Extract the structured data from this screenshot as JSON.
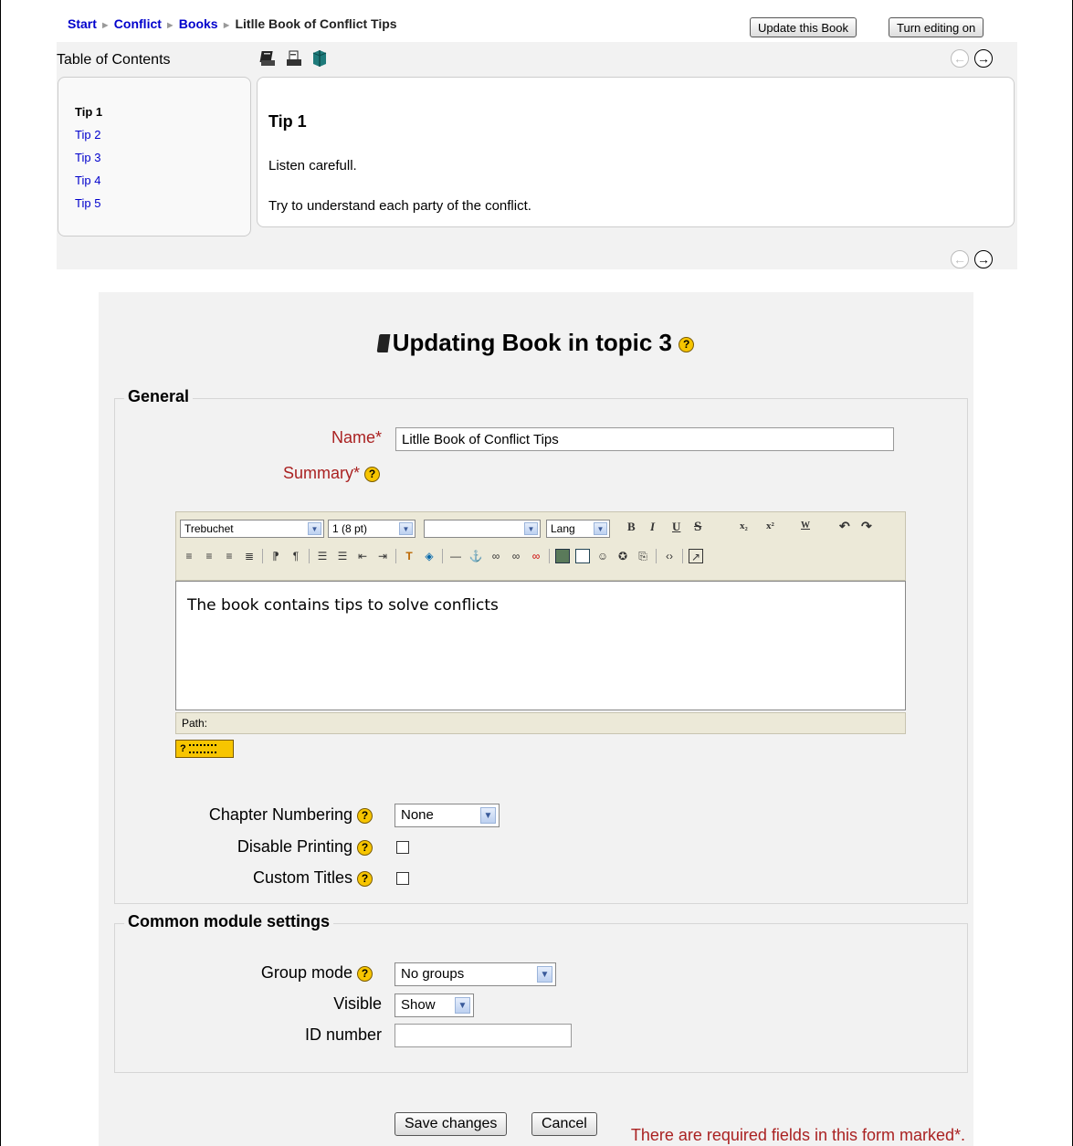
{
  "breadcrumb": {
    "items": [
      "Start",
      "Conflict",
      "Books"
    ],
    "current": "Litlle Book of Conflict Tips",
    "separator": "►"
  },
  "header_buttons": {
    "update_book": "Update this Book",
    "editing": "Turn editing on"
  },
  "toc": {
    "heading": "Table of Contents",
    "items": [
      "Tip 1",
      "Tip 2",
      "Tip 3",
      "Tip 4",
      "Tip 5"
    ],
    "current_index": 0
  },
  "chapter": {
    "title": "Tip 1",
    "paragraphs": [
      "Listen carefull.",
      "Try to understand each party of the conflict."
    ]
  },
  "icons": {
    "print_book": "print-book-icon",
    "print_chapter": "print-chapter-icon",
    "export": "export-icon",
    "prev": "previous-arrow-icon",
    "next": "next-arrow-icon",
    "help": "help-icon"
  },
  "form": {
    "title": "Updating Book in topic 3",
    "general": {
      "legend": "General",
      "name_label": "Name*",
      "name_value": "Litlle Book of Conflict Tips",
      "summary_label": "Summary*",
      "editor": {
        "font": "Trebuchet",
        "size": "1 (8 pt)",
        "format": "",
        "lang": "Lang",
        "content": "The book contains tips to solve conflicts",
        "path_label": "Path:"
      },
      "chapter_numbering_label": "Chapter Numbering",
      "chapter_numbering_value": "None",
      "disable_printing_label": "Disable Printing",
      "disable_printing_checked": false,
      "custom_titles_label": "Custom Titles",
      "custom_titles_checked": false
    },
    "common": {
      "legend": "Common module settings",
      "group_mode_label": "Group mode",
      "group_mode_value": "No groups",
      "visible_label": "Visible",
      "visible_value": "Show",
      "id_number_label": "ID number",
      "id_number_value": ""
    },
    "buttons": {
      "save": "Save changes",
      "cancel": "Cancel"
    },
    "required_note": "There are required fields in this form marked*."
  },
  "colors": {
    "link": "#0000cc",
    "required": "#aa2222",
    "panel_bg": "#f2f2f2",
    "help_icon": "#f7c500"
  }
}
